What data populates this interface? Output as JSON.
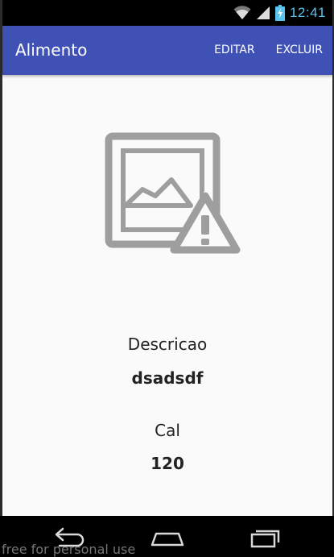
{
  "status_bar": {
    "time": "12:41",
    "icons": [
      "wifi-icon",
      "cell-signal-icon",
      "battery-charging-icon"
    ],
    "time_color": "#58c4f0"
  },
  "app_bar": {
    "title": "Alimento",
    "actions": {
      "edit": "EDITAR",
      "delete": "EXCLUIR"
    },
    "color": "#3f51b5"
  },
  "content": {
    "image_icon": "broken-image-icon",
    "fields": [
      {
        "label": "Descricao",
        "value": "dsadsdf"
      },
      {
        "label": "Cal",
        "value": "120"
      }
    ]
  },
  "nav_bar": {
    "icons": [
      "back-icon",
      "home-icon",
      "recents-icon"
    ]
  },
  "watermark": "free for personal use"
}
